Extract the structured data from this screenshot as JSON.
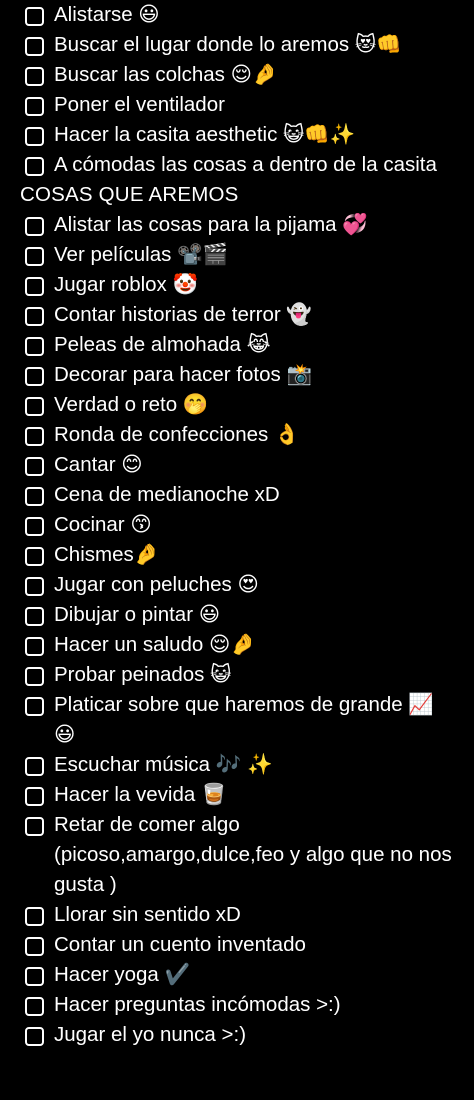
{
  "items_a": [
    {
      "text": "Alistarse 😃"
    },
    {
      "text": "Buscar el lugar donde lo aremos 😻👊"
    },
    {
      "text": "Buscar las colchas 😌🤌"
    },
    {
      "text": "Poner el ventilador"
    },
    {
      "text": "Hacer la casita aesthetic 😺👊✨"
    },
    {
      "text": "A cómodas las cosas a dentro de la casita"
    }
  ],
  "section_header": "COSAS QUE AREMOS",
  "items_b": [
    {
      "text": "Alistar las cosas para la pijama 💞"
    },
    {
      "text": "Ver películas 📽️🎬"
    },
    {
      "text": "Jugar roblox 🤡"
    },
    {
      "text": "Contar historias de terror 👻"
    },
    {
      "text": "Peleas de almohada 😹"
    },
    {
      "text": "Decorar para hacer fotos 📸"
    },
    {
      "text": "Verdad o reto 🤭"
    },
    {
      "text": "Ronda de confecciones 👌"
    },
    {
      "text": "Cantar 😊"
    },
    {
      "text": "Cena de medianoche xD"
    },
    {
      "text": "Cocinar 😙"
    },
    {
      "text": "Chismes🤌"
    },
    {
      "text": "Jugar con peluches 😍"
    },
    {
      "text": "Dibujar o pintar 😃"
    },
    {
      "text": "Hacer un saludo 😌🤌"
    },
    {
      "text": "Probar peinados 😺"
    },
    {
      "text": "Platicar sobre que haremos de grande 📈😃"
    },
    {
      "text": "Escuchar música 🎶 ✨"
    },
    {
      "text": "Hacer la vevida 🥃"
    },
    {
      "text": "Retar de comer algo (picoso,amargo,dulce,feo y algo que no nos gusta  )"
    },
    {
      "text": "Llorar sin sentido xD"
    },
    {
      "text": "Contar un cuento inventado"
    },
    {
      "text": "Hacer yoga ✔️"
    },
    {
      "text": "Hacer preguntas incómodas >:)"
    },
    {
      "text": "Jugar el yo nunca >:)"
    }
  ]
}
